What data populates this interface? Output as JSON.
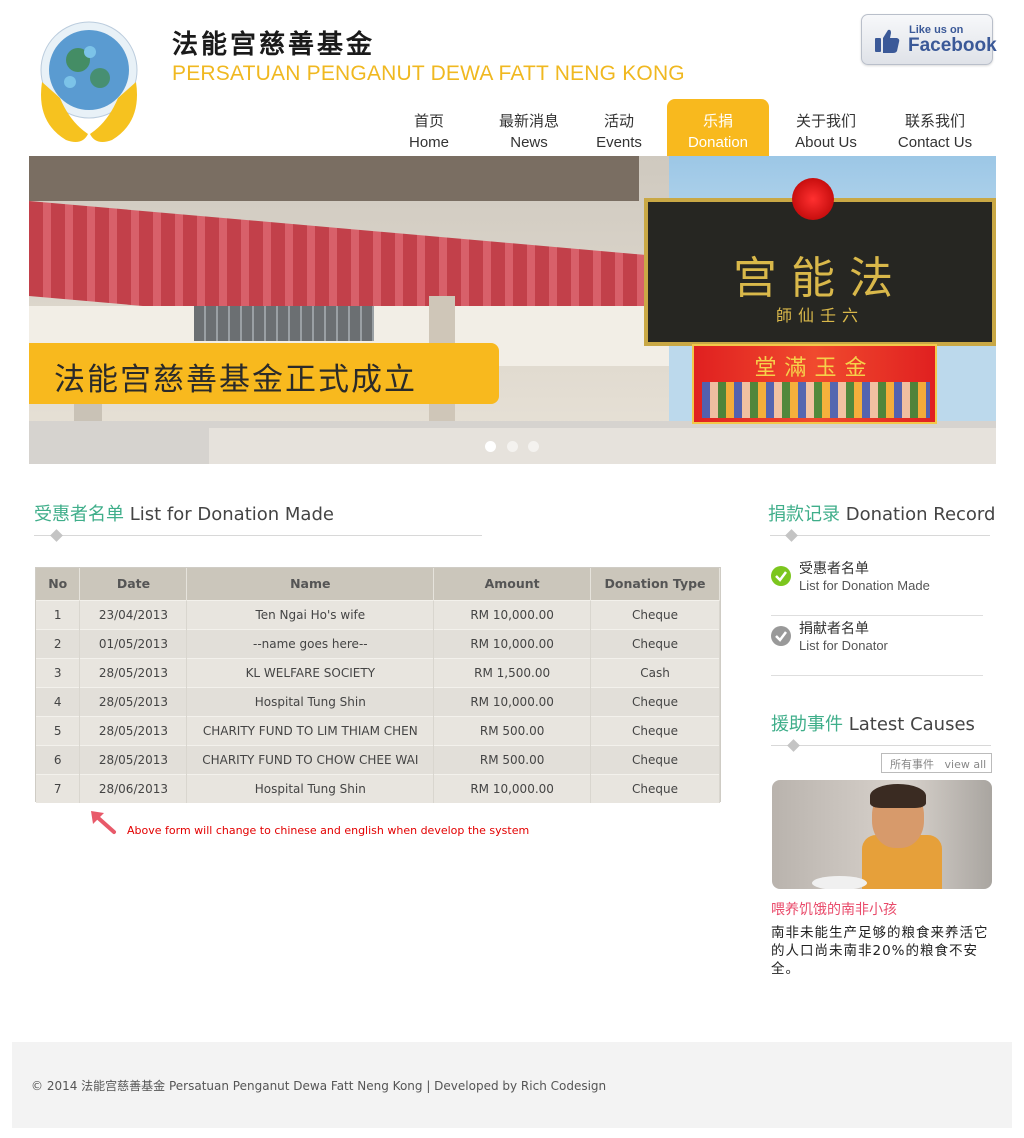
{
  "header": {
    "title_cn": "法能宫慈善基金",
    "title_en": "PERSATUAN PENGANUT DEWA FATT NENG KONG",
    "facebook_small": "Like us on",
    "facebook_big": "Facebook"
  },
  "nav": [
    {
      "cn": "首页",
      "en": "Home"
    },
    {
      "cn": "最新消息",
      "en": "News"
    },
    {
      "cn": "活动",
      "en": "Events"
    },
    {
      "cn": "乐捐",
      "en": "Donation"
    },
    {
      "cn": "关于我们",
      "en": "About Us"
    },
    {
      "cn": "联系我们",
      "en": "Contact Us"
    }
  ],
  "hero": {
    "caption": "法能宫慈善基金正式成立",
    "sign_text": "宫能法",
    "sign_sub": "師仙壬六",
    "banner_text": "堂滿玉金",
    "slides": 3,
    "active_slide": 1
  },
  "main": {
    "title_cn": "受惠者名单",
    "title_en": "List for Donation Made",
    "columns": [
      "No",
      "Date",
      "Name",
      "Amount",
      "Donation Type"
    ],
    "rows": [
      [
        "1",
        "23/04/2013",
        "Ten Ngai Ho's wife",
        "RM 10,000.00",
        "Cheque"
      ],
      [
        "2",
        "01/05/2013",
        "--name goes here--",
        "RM 10,000.00",
        "Cheque"
      ],
      [
        "3",
        "28/05/2013",
        "KL WELFARE SOCIETY",
        "RM 1,500.00",
        "Cash"
      ],
      [
        "4",
        "28/05/2013",
        "Hospital Tung Shin",
        "RM 10,000.00",
        "Cheque"
      ],
      [
        "5",
        "28/05/2013",
        "CHARITY FUND TO LIM THIAM CHEN",
        "RM 500.00",
        "Cheque"
      ],
      [
        "6",
        "28/05/2013",
        "CHARITY FUND TO CHOW CHEE WAI",
        "RM 500.00",
        "Cheque"
      ],
      [
        "7",
        "28/06/2013",
        "Hospital Tung Shin",
        "RM 10,000.00",
        "Cheque"
      ]
    ],
    "note": "Above form will change to chinese and english when develop the system"
  },
  "sidebar": {
    "record_title_cn": "捐款记录",
    "record_title_en": "Donation Record",
    "records": [
      {
        "cn": "受惠者名单",
        "en": "List for Donation Made",
        "icon": "check-circle-green-icon"
      },
      {
        "cn": "捐献者名单",
        "en": "List for Donator",
        "icon": "check-circle-gray-icon"
      }
    ],
    "causes_title_cn": "援助事件",
    "causes_title_en": "Latest Causes",
    "view_all_cn": "所有事件",
    "view_all_en": "view all",
    "cause_title": "喂养饥饿的南非小孩",
    "cause_desc": "南非未能生产足够的粮食来养活它的人口尚未南非20%的粮食不安全。"
  },
  "footer": {
    "text": "© 2014 法能宫慈善基金  Persatuan Penganut Dewa Fatt Neng Kong  |   Developed by Rich Codesign"
  },
  "colors": {
    "accent": "#f8b91e",
    "teal": "#3fae8a",
    "note_red": "#e30000",
    "cause_pink": "#e94b6b"
  }
}
